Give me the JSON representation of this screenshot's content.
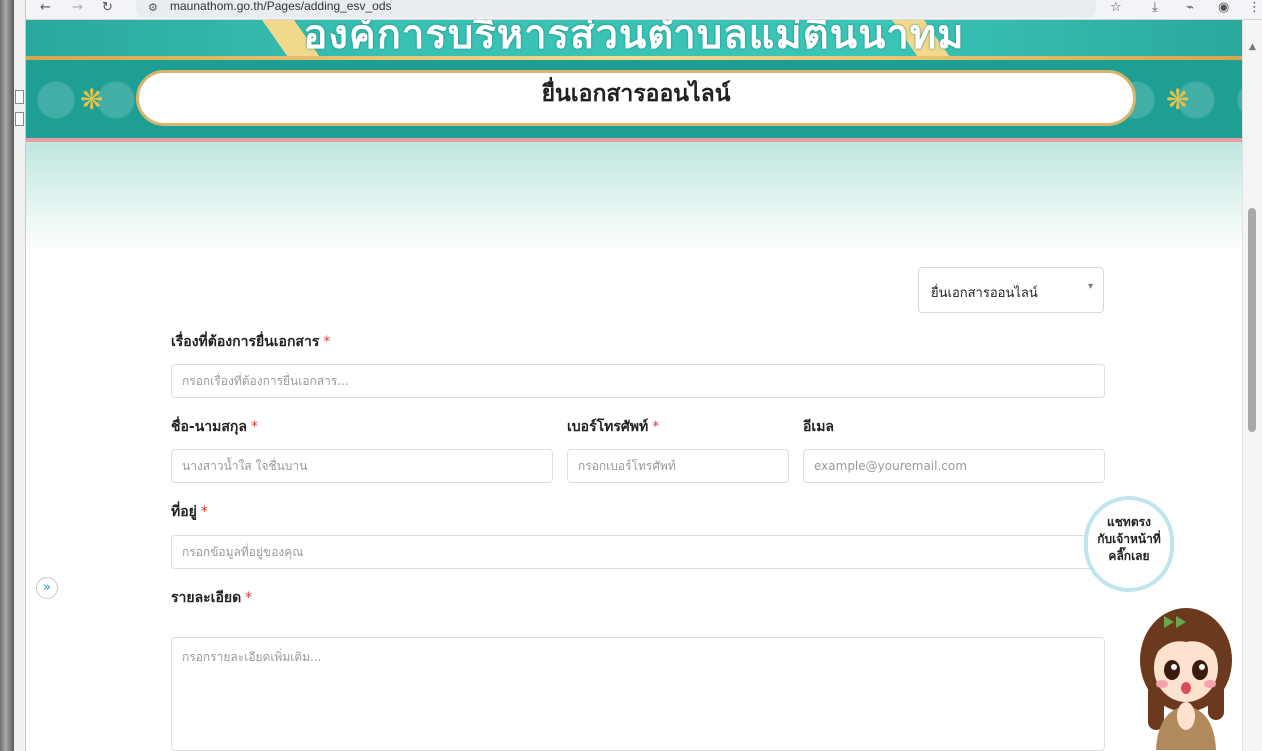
{
  "browser": {
    "url": "maunathom.go.th/Pages/adding_esv_ods",
    "back_icon": "arrow-left-icon",
    "forward_icon": "arrow-right-icon",
    "reload_icon": "reload-icon"
  },
  "site": {
    "org_name": "องค์การบริหารส่วนตำบลแม่ตื่นนาทม",
    "page_title": "ยื่นเอกสารออนไลน์"
  },
  "form": {
    "doc_type": {
      "selected": "ยื่นเอกสารออนไลน์"
    },
    "subject": {
      "label": "เรื่องที่ต้องการยื่นเอกสาร",
      "placeholder": "กรอกเรื่องที่ต้องการยื่นเอกสาร..."
    },
    "fullname": {
      "label": "ชื่อ-นามสกุล",
      "placeholder": "นางสาวน้ำใส ใจชื่นบาน"
    },
    "phone": {
      "label": "เบอร์โทรศัพท์",
      "placeholder": "กรอกเบอร์โทรศัพท์"
    },
    "email": {
      "label": "อีเมล",
      "placeholder": "example@youremail.com"
    },
    "address": {
      "label": "ที่อยู่",
      "placeholder": "กรอกข้อมูลที่อยู่ของคุณ"
    },
    "detail": {
      "label": "รายละเอียด",
      "placeholder": "กรอกรายละเอียดเพิ่มเติม..."
    },
    "required_mark": "*"
  },
  "chat": {
    "line1": "แชทตรง",
    "line2": "กับเจ้าหน้าที่",
    "line3": "คลิ๊กเลย"
  },
  "side_toggle": "»"
}
